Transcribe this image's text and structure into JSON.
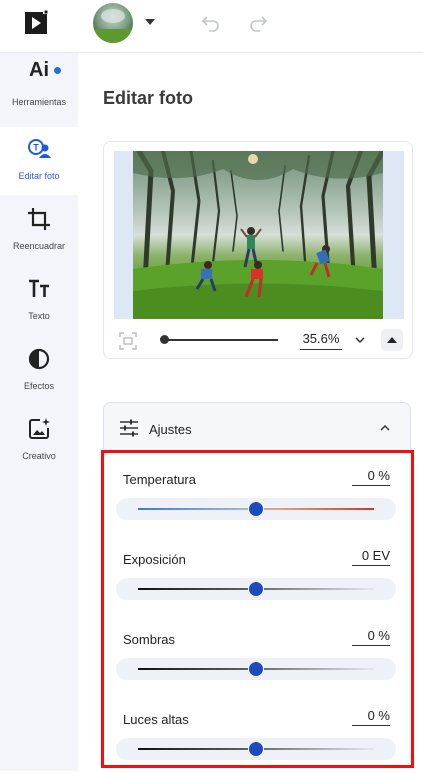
{
  "topbar": {
    "logo": "play-logo-icon",
    "avatar": "avatar-photo",
    "undo": "undo-icon",
    "redo": "redo-icon"
  },
  "sidebar": {
    "items": [
      {
        "label": "Herramientas",
        "icon": "ai-icon",
        "badge": true
      },
      {
        "label": "Editar foto",
        "icon": "edit-photo-icon",
        "active": true
      },
      {
        "label": "Reencuadrar",
        "icon": "crop-icon"
      },
      {
        "label": "Texto",
        "icon": "text-icon"
      },
      {
        "label": "Efectos",
        "icon": "effects-icon"
      },
      {
        "label": "Creativo",
        "icon": "creative-icon"
      }
    ],
    "ai_text": "Ai"
  },
  "main": {
    "title": "Editar foto",
    "zoom": {
      "value": "35.6%",
      "level": 0.0
    }
  },
  "adjustments": {
    "title": "Ajustes",
    "rows": [
      {
        "label": "Temperatura",
        "value": "0 %",
        "position": 0.5
      },
      {
        "label": "Exposición",
        "value": "0 EV",
        "position": 0.5
      },
      {
        "label": "Sombras",
        "value": "0 %",
        "position": 0.5
      },
      {
        "label": "Luces altas",
        "value": "0 %",
        "position": 0.5
      }
    ]
  },
  "colors": {
    "accent": "#1d4bbd",
    "highlight_border": "#f01010",
    "active_label": "#2f5bd8"
  }
}
